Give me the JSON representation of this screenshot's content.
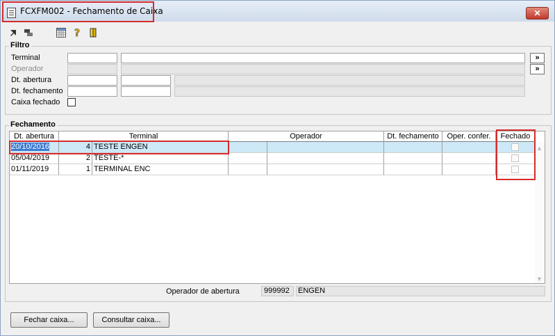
{
  "window": {
    "title": "FCXFM002 - Fechamento de Caixa",
    "close_label": "✕"
  },
  "toolbar": {
    "icons": [
      "arrow-out-icon",
      "transfer-icon",
      "calculator-icon",
      "help-icon",
      "exit-door-icon"
    ]
  },
  "filtro": {
    "label": "Filtro",
    "terminal_label": "Terminal",
    "terminal_code": "",
    "terminal_name": "",
    "operador_label": "Operador",
    "dt_abertura_label": "Dt. abertura",
    "dt_fechamento_label": "Dt. fechamento",
    "caixa_fechado_label": "Caixa fechado",
    "search_button": "»"
  },
  "fechamento": {
    "label": "Fechamento",
    "columns": [
      "Dt. abertura",
      "Terminal",
      "Operador",
      "Dt. fechamento",
      "Oper. confer.",
      "Fechado"
    ],
    "rows": [
      {
        "dt_abertura": "20/10/2016",
        "terminal_num": "4",
        "terminal_name": "TESTE ENGEN",
        "operador": "",
        "dt_fechamento": "",
        "oper_confer": "",
        "fechado": false
      },
      {
        "dt_abertura": "05/04/2019",
        "terminal_num": "2",
        "terminal_name": "TESTE-*",
        "operador": "",
        "dt_fechamento": "",
        "oper_confer": "",
        "fechado": false
      },
      {
        "dt_abertura": "01/11/2019",
        "terminal_num": "1",
        "terminal_name": "TERMINAL ENC",
        "operador": "",
        "dt_fechamento": "",
        "oper_confer": "",
        "fechado": false
      }
    ],
    "operador_abertura_label": "Operador de abertura",
    "operador_abertura_code": "999992",
    "operador_abertura_name": "ENGEN"
  },
  "buttons": {
    "fechar_caixa": "Fechar caixa...",
    "consultar_caixa": "Consultar caixa..."
  },
  "colors": {
    "highlight": "#d52b2b",
    "selection": "#3b7bd1",
    "row_selected": "#cde8f7"
  }
}
